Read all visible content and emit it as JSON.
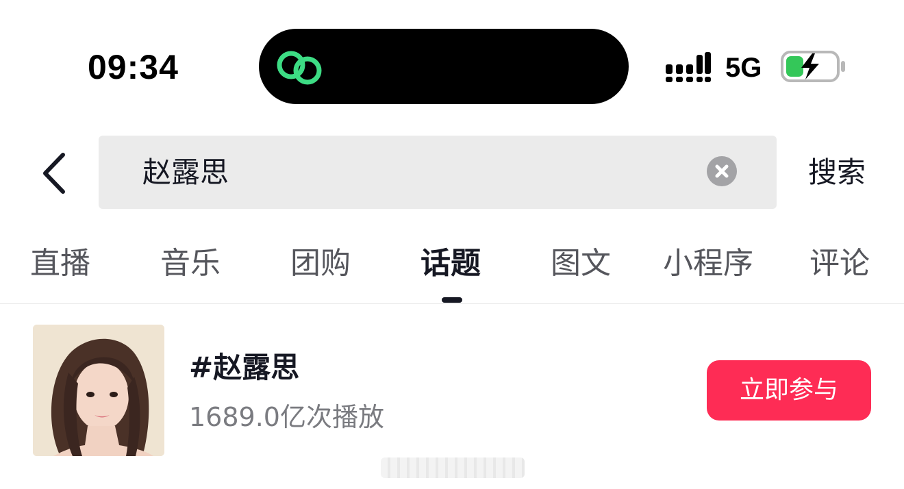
{
  "status_bar": {
    "time": "09:34",
    "network": "5G",
    "icons": [
      "app-link-icon",
      "signal-icon",
      "battery-charging-icon"
    ],
    "island_icon_color": "#3ddc84",
    "battery_level": 0.35,
    "battery_color": "#34c759"
  },
  "search": {
    "value": "赵露思",
    "submit_label": "搜索",
    "back_icon": "chevron-left-icon",
    "clear_icon": "clear-circle-icon"
  },
  "tabs": [
    {
      "label": "直播",
      "active": false
    },
    {
      "label": "音乐",
      "active": false
    },
    {
      "label": "团购",
      "active": false
    },
    {
      "label": "话题",
      "active": true
    },
    {
      "label": "图文",
      "active": false
    },
    {
      "label": "小程序",
      "active": false
    },
    {
      "label": "评论",
      "active": false
    }
  ],
  "topic": {
    "title": "#赵露思",
    "plays": "1689.0亿次播放",
    "join_label": "立即参与",
    "accent": "#fe2c55"
  }
}
